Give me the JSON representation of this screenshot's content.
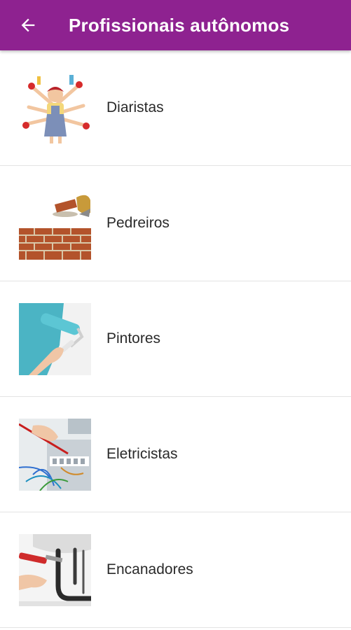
{
  "header": {
    "title": "Profissionais autônomos",
    "background": "#8e2290"
  },
  "list": {
    "items": [
      {
        "label": "Diaristas",
        "icon": "housekeeper-icon"
      },
      {
        "label": "Pedreiros",
        "icon": "brick-wall-icon"
      },
      {
        "label": "Pintores",
        "icon": "paint-roller-icon"
      },
      {
        "label": "Eletricistas",
        "icon": "electrical-panel-icon"
      },
      {
        "label": "Encanadores",
        "icon": "plumbing-pipes-icon"
      }
    ]
  }
}
